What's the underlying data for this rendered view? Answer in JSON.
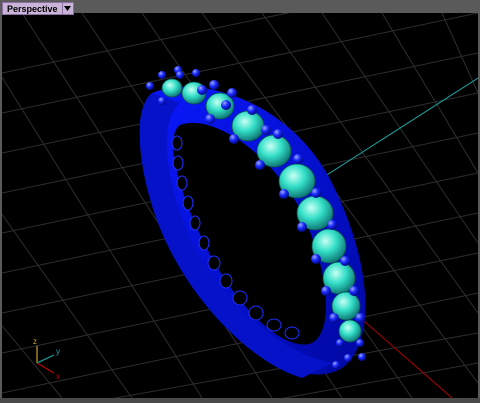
{
  "viewport": {
    "name": "Perspective",
    "axes": {
      "x": "x",
      "y": "y",
      "z": "z"
    }
  },
  "colors": {
    "background": "#000000",
    "grid": "#3a3a3a",
    "band": "#0a12e0",
    "gem": "#34e0c8",
    "prong": "#1420ff",
    "axis_x": "#c00000",
    "axis_y": "#1aa8a8",
    "label_bg": "#c9b3d6"
  },
  "icons": {
    "view_menu": "chevron-down-icon"
  }
}
